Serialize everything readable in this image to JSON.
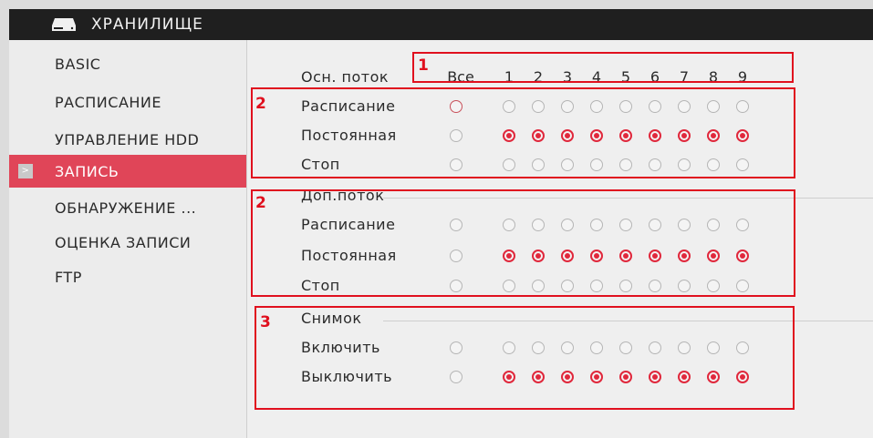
{
  "window": {
    "title": "ХРАНИЛИЩЕ"
  },
  "sidebar": {
    "items": [
      {
        "label": "BASIC"
      },
      {
        "label": "РАСПИСАНИЕ"
      },
      {
        "label": "УПРАВЛЕНИЕ HDD"
      },
      {
        "label": "ЗАПИСЬ",
        "active": true
      },
      {
        "label": "ОБНАРУЖЕНИЕ ..."
      },
      {
        "label": "ОЦЕНКА ЗАПИСИ"
      },
      {
        "label": "FTP"
      }
    ]
  },
  "grid": {
    "main_stream_label": "Осн. поток",
    "all_label": "Все",
    "channels": [
      "1",
      "2",
      "3",
      "4",
      "5",
      "6",
      "7",
      "8",
      "9"
    ],
    "sections": [
      {
        "title": "",
        "rows": [
          {
            "label": "Расписание",
            "all": false,
            "states": [
              false,
              false,
              false,
              false,
              false,
              false,
              false,
              false,
              false
            ]
          },
          {
            "label": "Постоянная",
            "all": false,
            "states": [
              true,
              true,
              true,
              true,
              true,
              true,
              true,
              true,
              true
            ]
          },
          {
            "label": "Стоп",
            "all": false,
            "states": [
              false,
              false,
              false,
              false,
              false,
              false,
              false,
              false,
              false
            ]
          }
        ]
      },
      {
        "title": "Доп.поток",
        "rows": [
          {
            "label": "Расписание",
            "all": false,
            "states": [
              false,
              false,
              false,
              false,
              false,
              false,
              false,
              false,
              false
            ]
          },
          {
            "label": "Постоянная",
            "all": false,
            "states": [
              true,
              true,
              true,
              true,
              true,
              true,
              true,
              true,
              true
            ]
          },
          {
            "label": "Стоп",
            "all": false,
            "states": [
              false,
              false,
              false,
              false,
              false,
              false,
              false,
              false,
              false
            ]
          }
        ]
      },
      {
        "title": "Снимок",
        "rows": [
          {
            "label": "Включить",
            "all": false,
            "states": [
              false,
              false,
              false,
              false,
              false,
              false,
              false,
              false,
              false
            ]
          },
          {
            "label": "Выключить",
            "all": false,
            "states": [
              true,
              true,
              true,
              true,
              true,
              true,
              true,
              true,
              true
            ]
          }
        ]
      }
    ]
  },
  "annotations": [
    {
      "number": "1"
    },
    {
      "number": "2"
    },
    {
      "number": "2"
    },
    {
      "number": "3"
    }
  ],
  "colors": {
    "accent": "#e04558",
    "radio_on": "#e0283c",
    "annotation": "#e0101e",
    "titlebar": "#1f1f1f"
  }
}
